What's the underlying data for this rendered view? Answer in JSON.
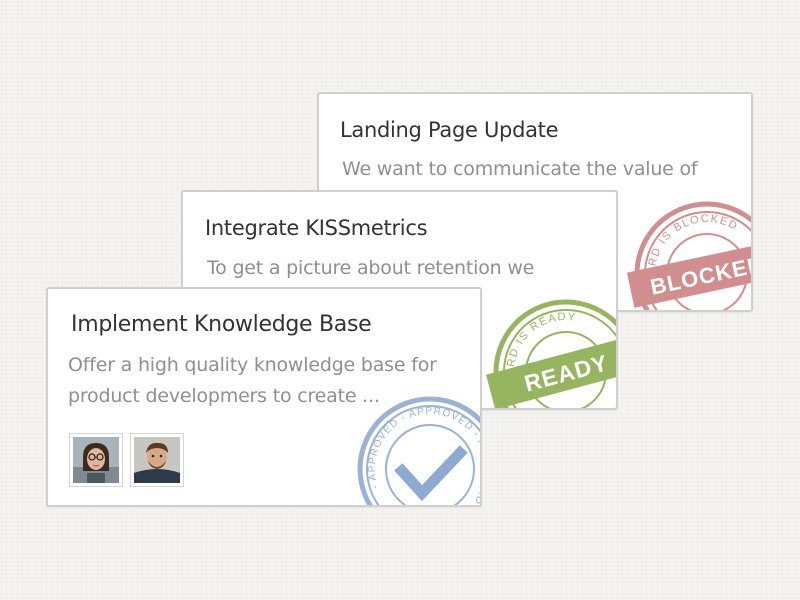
{
  "cards": [
    {
      "title": "Landing Page Update",
      "description_lines": [
        "We want to communicate the value of"
      ],
      "stamp": {
        "label": "BLOCKED",
        "ring_text": "CARD IS BLOCKED",
        "color": "#c97b7b"
      }
    },
    {
      "title": "Integrate KISSmetrics",
      "description_lines": [
        "To get a picture about retention we"
      ],
      "stamp": {
        "label": "READY",
        "ring_text": "CARD IS READY",
        "color": "#8cad4f"
      }
    },
    {
      "title": "Implement Knowledge Base",
      "description_lines": [
        "Offer a high quality knowledge base for",
        "product developmers to create ..."
      ],
      "stamp": {
        "label": "",
        "ring_text": "- APPROVED - APPROVED - APPROVED -",
        "color": "#8faad2",
        "icon": "checkmark-icon"
      },
      "avatars": [
        {
          "name": "avatar-woman-icon"
        },
        {
          "name": "avatar-man-icon"
        }
      ]
    }
  ],
  "colors": {
    "background": "#f3f2ee",
    "card_border": "#cfcfcf",
    "title": "#333333",
    "description": "#8f8f8f",
    "blocked": "#c97b7b",
    "ready": "#8cad4f",
    "approved": "#8faad2"
  }
}
